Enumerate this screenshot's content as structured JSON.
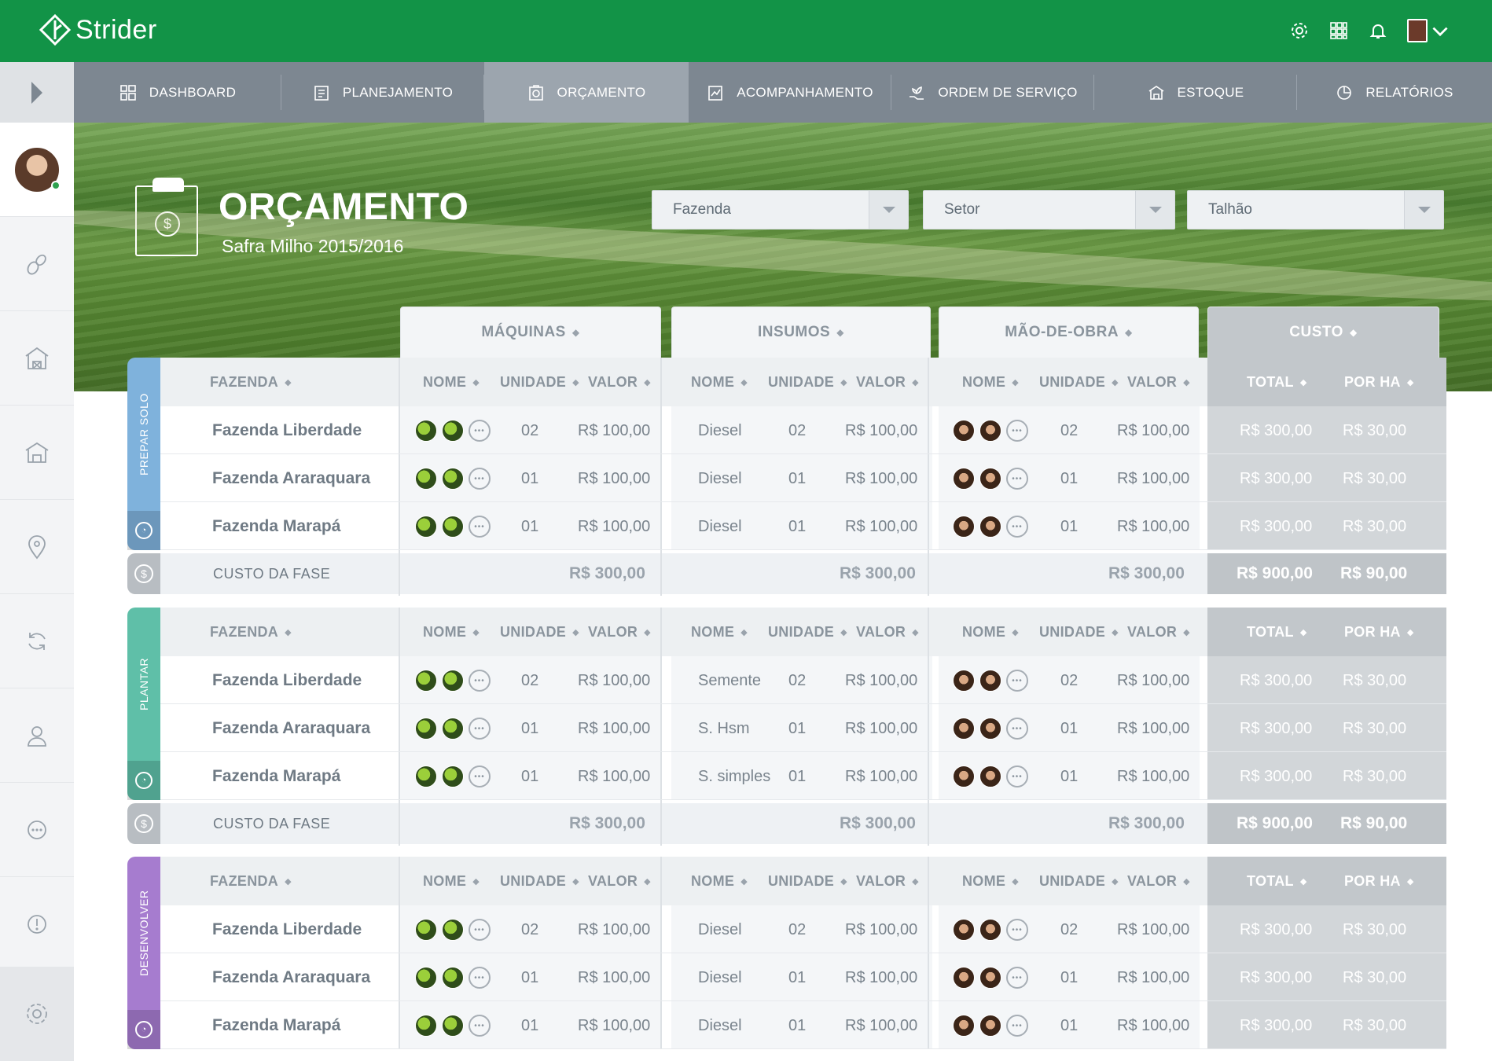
{
  "app": {
    "name": "Strider"
  },
  "nav": [
    {
      "label": "DASHBOARD",
      "icon": "dashboard-icon"
    },
    {
      "label": "PLANEJAMENTO",
      "icon": "planning-icon"
    },
    {
      "label": "ORÇAMENTO",
      "icon": "budget-icon"
    },
    {
      "label": "ACOMPANHAMENTO",
      "icon": "tracking-icon"
    },
    {
      "label": "ORDEM DE SERVIÇO",
      "icon": "service-order-icon"
    },
    {
      "label": "ESTOQUE",
      "icon": "stock-icon"
    },
    {
      "label": "RELATÓRIOS",
      "icon": "reports-icon"
    }
  ],
  "page": {
    "title": "ORÇAMENTO",
    "subtitle": "Safra Milho 2015/2016"
  },
  "filters": {
    "farm": "Fazenda",
    "sector": "Setor",
    "plot": "Talhão"
  },
  "groups": {
    "machines": "MÁQUINAS",
    "inputs": "INSUMOS",
    "labor": "MÃO-DE-OBRA",
    "cost": "CUSTO"
  },
  "columns": {
    "farm": "FAZENDA",
    "name": "NOME",
    "unit": "UNIDADE",
    "value": "VALOR",
    "total": "TOTAL",
    "per_ha": "POR HA"
  },
  "phase_cost_label": "CUSTO DA FASE",
  "colors": {
    "brand": "#129347",
    "preparo": "#7fb2dc",
    "plantar": "#5fbfa8",
    "desenvolver": "#a67ccf"
  },
  "phases": [
    {
      "name": "PREPAR SOLO",
      "rows": [
        {
          "farm": "Fazenda Liberdade",
          "m_unit": "02",
          "m_value": "R$ 100,00",
          "i_name": "Diesel",
          "i_unit": "02",
          "i_value": "R$ 100,00",
          "l_unit": "02",
          "l_value": "R$ 100,00",
          "total": "R$ 300,00",
          "per_ha": "R$ 30,00"
        },
        {
          "farm": "Fazenda Araraquara",
          "m_unit": "01",
          "m_value": "R$ 100,00",
          "i_name": "Diesel",
          "i_unit": "01",
          "i_value": "R$ 100,00",
          "l_unit": "01",
          "l_value": "R$ 100,00",
          "total": "R$ 300,00",
          "per_ha": "R$ 30,00"
        },
        {
          "farm": "Fazenda Marapá",
          "m_unit": "01",
          "m_value": "R$ 100,00",
          "i_name": "Diesel",
          "i_unit": "01",
          "i_value": "R$ 100,00",
          "l_unit": "01",
          "l_value": "R$ 100,00",
          "total": "R$ 300,00",
          "per_ha": "R$ 30,00"
        }
      ],
      "cost": {
        "machines": "R$ 300,00",
        "inputs": "R$ 300,00",
        "labor": "R$ 300,00",
        "total": "R$ 900,00",
        "per_ha": "R$ 90,00"
      }
    },
    {
      "name": "PLANTAR",
      "rows": [
        {
          "farm": "Fazenda Liberdade",
          "m_unit": "02",
          "m_value": "R$ 100,00",
          "i_name": "Semente",
          "i_unit": "02",
          "i_value": "R$ 100,00",
          "l_unit": "02",
          "l_value": "R$ 100,00",
          "total": "R$ 300,00",
          "per_ha": "R$ 30,00"
        },
        {
          "farm": "Fazenda Araraquara",
          "m_unit": "01",
          "m_value": "R$ 100,00",
          "i_name": "S. Hsm",
          "i_unit": "01",
          "i_value": "R$ 100,00",
          "l_unit": "01",
          "l_value": "R$ 100,00",
          "total": "R$ 300,00",
          "per_ha": "R$ 30,00"
        },
        {
          "farm": "Fazenda Marapá",
          "m_unit": "01",
          "m_value": "R$ 100,00",
          "i_name": "S. simples",
          "i_unit": "01",
          "i_value": "R$ 100,00",
          "l_unit": "01",
          "l_value": "R$ 100,00",
          "total": "R$ 300,00",
          "per_ha": "R$ 30,00"
        }
      ],
      "cost": {
        "machines": "R$ 300,00",
        "inputs": "R$ 300,00",
        "labor": "R$ 300,00",
        "total": "R$ 900,00",
        "per_ha": "R$ 90,00"
      }
    },
    {
      "name": "DESENVOLVER",
      "rows": [
        {
          "farm": "Fazenda Liberdade",
          "m_unit": "02",
          "m_value": "R$ 100,00",
          "i_name": "Diesel",
          "i_unit": "02",
          "i_value": "R$ 100,00",
          "l_unit": "02",
          "l_value": "R$ 100,00",
          "total": "R$ 300,00",
          "per_ha": "R$ 30,00"
        },
        {
          "farm": "Fazenda Araraquara",
          "m_unit": "01",
          "m_value": "R$ 100,00",
          "i_name": "Diesel",
          "i_unit": "01",
          "i_value": "R$ 100,00",
          "l_unit": "01",
          "l_value": "R$ 100,00",
          "total": "R$ 300,00",
          "per_ha": "R$ 30,00"
        },
        {
          "farm": "Fazenda Marapá",
          "m_unit": "01",
          "m_value": "R$ 100,00",
          "i_name": "Diesel",
          "i_unit": "01",
          "i_value": "R$ 100,00",
          "l_unit": "01",
          "l_value": "R$ 100,00",
          "total": "R$ 300,00",
          "per_ha": "R$ 30,00"
        }
      ]
    }
  ]
}
